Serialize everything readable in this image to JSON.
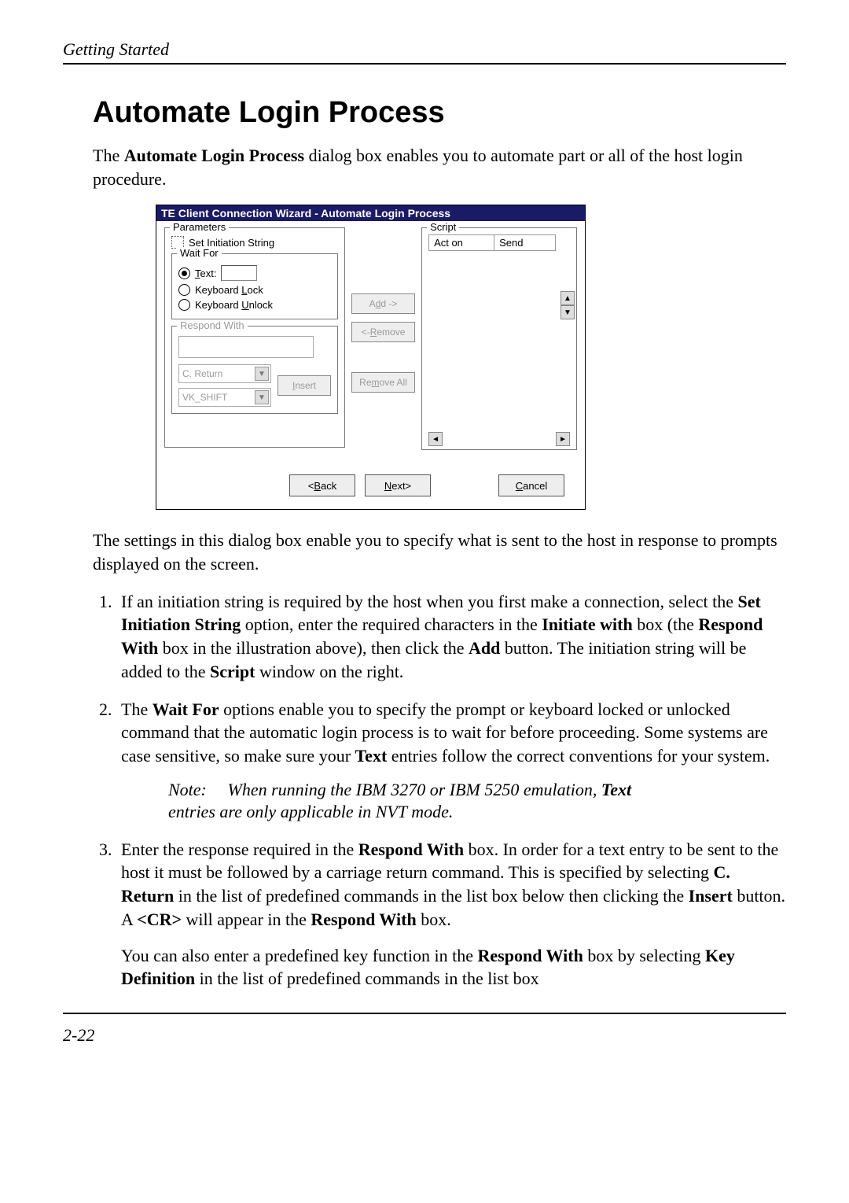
{
  "header": {
    "running": "Getting Started"
  },
  "title": "Automate Login Process",
  "intro_a": "The ",
  "intro_b_bold": "Automate Login Process",
  "intro_c": " dialog box enables you to automate part or all of the host login procedure.",
  "dialog": {
    "title": "TE Client Connection Wizard - Automate Login Process",
    "parameters_legend": "Parameters",
    "set_initiation_a": "S",
    "set_initiation_b": "et Initiation String",
    "waitfor_legend": "Wait For",
    "text_label_a": "T",
    "text_label_b": "ext:",
    "kb_lock_a": "Keyboard ",
    "kb_lock_u": "L",
    "kb_lock_b": "ock",
    "kb_unlock_a": "Keyboard ",
    "kb_unlock_u": "U",
    "kb_unlock_b": "nlock",
    "respond_legend": "Respond With",
    "sel_creturn": "C. Return",
    "sel_vkshift": "VK_SHIFT",
    "insert_u": "I",
    "insert_rest": "nsert",
    "add_a": "A",
    "add_u": "d",
    "add_b": "d ->",
    "remove_a": "<- ",
    "remove_u": "R",
    "remove_b": "emove",
    "removeall_a": "Re",
    "removeall_u": "m",
    "removeall_b": "ove All",
    "script_legend": "Script",
    "col_acton": "Act on",
    "col_send": "Send",
    "back_a": "<",
    "back_u": "B",
    "back_b": "ack",
    "next_u": "N",
    "next_b": "ext>",
    "cancel_u": "C",
    "cancel_b": "ancel"
  },
  "after_dialog": "The settings in this dialog box enable you to specify what is sent to the host in response to prompts displayed on the screen.",
  "step1": {
    "a": "If an initiation string is required by the host when you first make a connection, select the ",
    "b": "Set Initiation String",
    "c": " option, enter the required characters in the ",
    "d": "Initiate with",
    "e": " box (the ",
    "f": "Respond With",
    "g": " box in the illustration above), then click the ",
    "h": "Add",
    "i": " button. The initiation string will be added to the ",
    "j": "Script",
    "k": " window on the right."
  },
  "step2": {
    "a": "The ",
    "b": "Wait For",
    "c": " options enable you to specify the prompt or keyboard locked or unlocked command that the automatic login process is to wait for before proceeding. Some systems are case sensitive, so make sure your ",
    "d": "Text",
    "e": " entries follow the correct conventions for your system."
  },
  "note": {
    "label": "Note:",
    "body_a": "When running the IBM 3270 or IBM 5250 emulation, ",
    "body_b": "Text",
    "body_c": " entries are only applicable in NVT mode."
  },
  "step3": {
    "a": "Enter the response required in the ",
    "b": "Respond With",
    "c": " box. In order for a text entry to be sent to the host it must be followed by a carriage return command. This is specified by selecting ",
    "d": "C. Return",
    "e": " in the list of predefined commands in the list box below then clicking the ",
    "f": "Insert",
    "g": " button. A ",
    "h": "<CR>",
    "i": " will appear in the ",
    "j": "Respond With",
    "k": " box.",
    "p2a": "You can also enter a predefined key function in the ",
    "p2b": "Respond With",
    "p2c": " box by selecting ",
    "p2d": "Key Definition",
    "p2e": " in the list of predefined commands in the list box"
  },
  "page_number": "2-22"
}
